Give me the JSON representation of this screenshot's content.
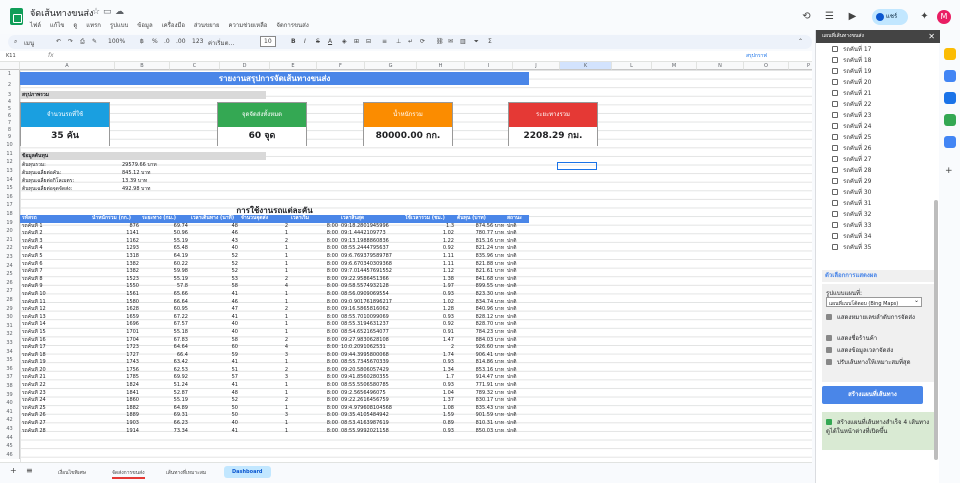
{
  "app": {
    "doc_title": "จัดเส้นทางขนส่ง",
    "menu": [
      "ไฟล์",
      "แก้ไข",
      "ดู",
      "แทรก",
      "รูปแบบ",
      "ข้อมูล",
      "เครื่องมือ",
      "ส่วนขยาย",
      "ความช่วยเหลือ",
      "จัดการขนส่ง"
    ],
    "share_label": "แชร์",
    "avatar_letter": "M"
  },
  "toolbar": {
    "search_label": "เมนู",
    "zoom": "100%",
    "currency": "฿",
    "percent": "%",
    "dec_less": ".0",
    "dec_more": ".00",
    "number_fmt": "123",
    "font": "ค่าเริ่มต...",
    "font_size": "10",
    "bold": "B",
    "italic": "I",
    "strike": "S",
    "text_color": "A"
  },
  "formula": {
    "name_box": "K11",
    "fx": "fx",
    "header_button": "สรุปกราฟ"
  },
  "columns": [
    "A",
    "B",
    "C",
    "D",
    "E",
    "F",
    "G",
    "H",
    "I",
    "J",
    "K",
    "L",
    "M",
    "N",
    "O",
    "P"
  ],
  "report": {
    "banner": "รายงานสรุปการจัดเส้นทางขนส่ง",
    "overview": "สรุปภาพรวม",
    "cards": [
      {
        "label": "จำนวนรถที่ใช้",
        "value": "35 คัน",
        "color": "#1a9fe0"
      },
      {
        "label": "จุดจัดส่งทั้งหมด",
        "value": "60 จุด",
        "color": "#34a853"
      },
      {
        "label": "น้ำหนักรวม",
        "value": "80000.00 กก.",
        "color": "#fb8c00"
      },
      {
        "label": "ระยะทางรวม",
        "value": "2208.29 กม.",
        "color": "#e53935"
      }
    ],
    "cost_section": "ข้อมูลต้นทุน",
    "costs": [
      {
        "label": "ต้นทุนรวม:",
        "value": "29579.66 บาท"
      },
      {
        "label": "ต้นทุนเฉลี่ยต่อคัน:",
        "value": "845.12 บาท"
      },
      {
        "label": "ต้นทุนเฉลี่ยต่อกิโลเมตร:",
        "value": "13.39 บาท"
      },
      {
        "label": "ต้นทุนเฉลี่ยต่อจุดจัดส่ง:",
        "value": "492.98 บาท"
      }
    ],
    "table_title": "การใช้งานรถแต่ละคัน",
    "table_headers": [
      "รหัสรถ",
      "น้ำหนักรวม (กก.)",
      "ระยะทาง (กม.)",
      "เวลาเดินทาง (นาที)",
      "จำนวนจุดส่ง",
      "เวลาเริ่ม",
      "เวลาสิ้นสุด",
      "ใช้เวลารวม (ชม.)",
      "ต้นทุน (บาท)",
      "สถานะ"
    ],
    "rows": [
      [
        "รถคันที่ 1",
        "876",
        "69.74",
        "48",
        "2",
        "8:00",
        "09:18.2801945996",
        "1.3",
        "874.56 บาท",
        "ปกติ"
      ],
      [
        "รถคันที่ 2",
        "1141",
        "50.96",
        "46",
        "1",
        "8:00",
        "09:1.4442109773",
        "1.02",
        "780.77 บาท",
        "ปกติ"
      ],
      [
        "รถคันที่ 3",
        "1162",
        "55.19",
        "43",
        "2",
        "8:00",
        "09:13.1988860836",
        "1.22",
        "815.16 บาท",
        "ปกติ"
      ],
      [
        "รถคันที่ 4",
        "1293",
        "65.48",
        "40",
        "1",
        "8:00",
        "08:55.2444795637",
        "0.92",
        "821.24 บาท",
        "ปกติ"
      ],
      [
        "รถคันที่ 5",
        "1318",
        "64.19",
        "52",
        "1",
        "8:00",
        "09:6.769379589787",
        "1.11",
        "835.96 บาท",
        "ปกติ"
      ],
      [
        "รถคันที่ 6",
        "1382",
        "60.22",
        "52",
        "1",
        "8:00",
        "09:6.670340309368",
        "1.11",
        "821.88 บาท",
        "ปกติ"
      ],
      [
        "รถคันที่ 7",
        "1382",
        "59.98",
        "52",
        "1",
        "8:00",
        "09:7.014457691552",
        "1.12",
        "821.61 บาท",
        "ปกติ"
      ],
      [
        "รถคันที่ 8",
        "1523",
        "55.19",
        "53",
        "2",
        "8:00",
        "09:22.9586451366",
        "1.38",
        "841.68 บาท",
        "ปกติ"
      ],
      [
        "รถคันที่ 9",
        "1550",
        "57.8",
        "58",
        "4",
        "8:00",
        "09:58.5574932128",
        "1.97",
        "899.55 บาท",
        "ปกติ"
      ],
      [
        "รถคันที่ 10",
        "1561",
        "65.66",
        "41",
        "1",
        "8:00",
        "08:56.0909069554",
        "0.93",
        "823.30 บาท",
        "ปกติ"
      ],
      [
        "รถคันที่ 11",
        "1580",
        "66.64",
        "46",
        "1",
        "8:00",
        "09:0.901761896217",
        "1.02",
        "834.74 บาท",
        "ปกติ"
      ],
      [
        "รถคันที่ 12",
        "1628",
        "60.95",
        "47",
        "2",
        "8:00",
        "09:16.5865816062",
        "1.28",
        "840.96 บาท",
        "ปกติ"
      ],
      [
        "รถคันที่ 13",
        "1659",
        "67.22",
        "41",
        "1",
        "8:00",
        "08:55.7010099069",
        "0.93",
        "828.12 บาท",
        "ปกติ"
      ],
      [
        "รถคันที่ 14",
        "1696",
        "67.57",
        "40",
        "1",
        "8:00",
        "08:55.3194631237",
        "0.92",
        "828.70 บาท",
        "ปกติ"
      ],
      [
        "รถคันที่ 15",
        "1701",
        "55.18",
        "40",
        "1",
        "8:00",
        "08:54.6521654077",
        "0.91",
        "784.23 บาท",
        "ปกติ"
      ],
      [
        "รถคันที่ 16",
        "1704",
        "67.83",
        "58",
        "2",
        "8:00",
        "09:27.9830628108",
        "1.47",
        "884.03 บาท",
        "ปกติ"
      ],
      [
        "รถคันที่ 17",
        "1723",
        "64.64",
        "60",
        "4",
        "8:00",
        "10:0.2091062531",
        "2",
        "926.60 บาท",
        "ปกติ"
      ],
      [
        "รถคันที่ 18",
        "1727",
        "66.4",
        "59",
        "3",
        "8:00",
        "09:44.3995800068",
        "1.74",
        "906.41 บาท",
        "ปกติ"
      ],
      [
        "รถคันที่ 19",
        "1743",
        "63.42",
        "41",
        "1",
        "8:00",
        "08:55.7345670339",
        "0.93",
        "814.86 บาท",
        "ปกติ"
      ],
      [
        "รถคันที่ 20",
        "1756",
        "62.53",
        "51",
        "2",
        "8:00",
        "09:20.5806057429",
        "1.34",
        "853.16 บาท",
        "ปกติ"
      ],
      [
        "รถคันที่ 21",
        "1785",
        "69.92",
        "57",
        "3",
        "8:00",
        "09:41.8560280355",
        "1.7",
        "914.47 บาท",
        "ปกติ"
      ],
      [
        "รถคันที่ 22",
        "1824",
        "51.24",
        "41",
        "1",
        "8:00",
        "08:55.5506580785",
        "0.93",
        "771.91 บาท",
        "ปกติ"
      ],
      [
        "รถคันที่ 23",
        "1841",
        "52.87",
        "48",
        "1",
        "8:00",
        "09:2.5656496075",
        "1.04",
        "789.32 บาท",
        "ปกติ"
      ],
      [
        "รถคันที่ 24",
        "1860",
        "55.19",
        "52",
        "2",
        "8:00",
        "09:22.2616456759",
        "1.37",
        "830.17 บาท",
        "ปกติ"
      ],
      [
        "รถคันที่ 25",
        "1882",
        "64.89",
        "50",
        "1",
        "8:00",
        "09:4.979608104568",
        "1.08",
        "835.43 บาท",
        "ปกติ"
      ],
      [
        "รถคันที่ 26",
        "1889",
        "69.31",
        "50",
        "3",
        "8:00",
        "09:35.4105484942",
        "1.59",
        "901.59 บาท",
        "ปกติ"
      ],
      [
        "รถคันที่ 27",
        "1903",
        "66.23",
        "40",
        "1",
        "8:00",
        "08:53.4163987619",
        "0.89",
        "810.31 บาท",
        "ปกติ"
      ],
      [
        "รถคันที่ 28",
        "1914",
        "73.34",
        "41",
        "1",
        "8:00",
        "08:55.9992021158",
        "0.93",
        "850.03 บาท",
        "ปกติ"
      ]
    ]
  },
  "sheet_tabs": [
    "เงื่อนไขพิเศษ",
    "จัดส่งการขนส่ง",
    "เส้นทางที่เหมาะสม",
    "Dashboard"
  ],
  "sidebar": {
    "title": "แผนที่เส้นทางขนส่ง",
    "vehicles": [
      "รถคันที่ 17",
      "รถคันที่ 18",
      "รถคันที่ 19",
      "รถคันที่ 20",
      "รถคันที่ 21",
      "รถคันที่ 22",
      "รถคันที่ 23",
      "รถคันที่ 24",
      "รถคันที่ 25",
      "รถคันที่ 26",
      "รถคันที่ 27",
      "รถคันที่ 28",
      "รถคันที่ 29",
      "รถคันที่ 30",
      "รถคันที่ 31",
      "รถคันที่ 32",
      "รถคันที่ 33",
      "รถคันที่ 34",
      "รถคันที่ 35"
    ],
    "options_title": "ตัวเลือกการแสดงผล",
    "map_type_label": "รูปแบบแผนที่:",
    "map_type_value": "แผนที่แบบโต้ตอบ (Bing Maps)",
    "options": [
      "แสดงหมายเลขลำดับการจัดส่ง",
      "แสดงชื่อร้านค้า",
      "แสดงข้อมูลเวลาจัดส่ง",
      "ปรับเส้นทางให้เหมาะสมที่สุด"
    ],
    "build_button": "สร้างแผนที่เส้นทาง",
    "status": "สร้างแผนที่เส้นทางสำเร็จ 4 เส้นทาง ดูได้ในหน้าต่างที่เปิดขึ้น"
  },
  "rail_colors": [
    "#fbbc04",
    "#4285f4",
    "#1a73e8",
    "#34a853",
    "#4285f4"
  ]
}
